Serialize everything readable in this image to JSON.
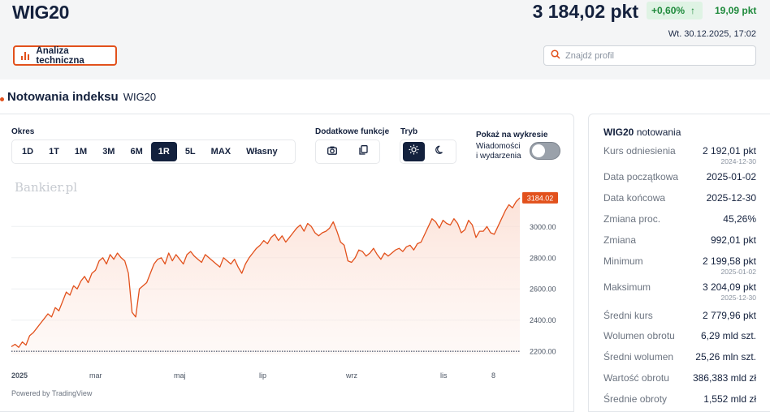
{
  "header": {
    "ticker": "WIG20",
    "price": "3 184,02 pkt",
    "change_pct": "+0,60%",
    "change_pkt": "19,09 pkt",
    "datetime": "Wt. 30.12.2025, 17:02",
    "tech_analysis_label": "Analiza techniczna",
    "search_placeholder": "Znajdź profil"
  },
  "section": {
    "title": "Notowania indeksu",
    "subtitle": "WIG20"
  },
  "controls": {
    "period_label": "Okres",
    "periods": [
      "1D",
      "1T",
      "1M",
      "3M",
      "6M",
      "1R",
      "5L",
      "MAX",
      "Własny"
    ],
    "active_period": "1R",
    "functions_label": "Dodatkowe funkcje",
    "mode_label": "Tryb",
    "show_label": "Pokaż na wykresie",
    "events_line1": "Wiadomości",
    "events_line2": "i wydarzenia"
  },
  "chart": {
    "watermark": "Bankier.pl",
    "powered_by": "Powered by TradingView",
    "last_label": "3184.02",
    "accent_color": "#e2511c"
  },
  "chart_data": {
    "type": "area",
    "x_ticks": [
      "2025",
      "mar",
      "maj",
      "lip",
      "wrz",
      "lis",
      "8"
    ],
    "y_ticks": [
      "2200.00",
      "2400.00",
      "2600.00",
      "2800.00",
      "3000.00"
    ],
    "ylim": [
      2200,
      3220
    ],
    "y": [
      2230,
      2245,
      2225,
      2260,
      2240,
      2300,
      2320,
      2350,
      2380,
      2410,
      2440,
      2420,
      2480,
      2460,
      2520,
      2580,
      2560,
      2620,
      2600,
      2650,
      2680,
      2640,
      2700,
      2720,
      2780,
      2800,
      2760,
      2820,
      2790,
      2830,
      2800,
      2780,
      2700,
      2450,
      2420,
      2600,
      2620,
      2640,
      2700,
      2760,
      2790,
      2800,
      2760,
      2830,
      2780,
      2820,
      2790,
      2760,
      2820,
      2840,
      2810,
      2790,
      2770,
      2820,
      2800,
      2780,
      2760,
      2740,
      2800,
      2780,
      2760,
      2790,
      2740,
      2700,
      2760,
      2800,
      2830,
      2860,
      2880,
      2910,
      2890,
      2930,
      2950,
      2910,
      2940,
      2900,
      2930,
      2960,
      2990,
      3010,
      2970,
      3020,
      3000,
      2960,
      2940,
      2960,
      2970,
      2990,
      3030,
      2970,
      2900,
      2880,
      2780,
      2770,
      2800,
      2850,
      2840,
      2810,
      2830,
      2860,
      2820,
      2790,
      2830,
      2810,
      2830,
      2850,
      2860,
      2840,
      2870,
      2880,
      2850,
      2890,
      2900,
      2950,
      3000,
      3050,
      3030,
      2990,
      3040,
      3020,
      3010,
      3050,
      3020,
      2960,
      2980,
      3040,
      3010,
      2930,
      2970,
      2970,
      3000,
      2960,
      2950,
      3000,
      3050,
      3100,
      3140,
      3120,
      3160,
      3184.02
    ],
    "ylabel": "",
    "xlabel": ""
  },
  "summary": {
    "title_bold": "WIG20",
    "title_rest": "notowania",
    "rows": [
      {
        "label": "Kurs odniesienia",
        "value": "2 192,01 pkt",
        "sub": "2024-12-30"
      },
      {
        "label": "Data początkowa",
        "value": "2025-01-02"
      },
      {
        "label": "Data końcowa",
        "value": "2025-12-30"
      },
      {
        "label": "Zmiana proc.",
        "value": "45,26%"
      },
      {
        "label": "Zmiana",
        "value": "992,01 pkt"
      },
      {
        "label": "Minimum",
        "value": "2 199,58 pkt",
        "sub": "2025-01-02"
      },
      {
        "label": "Maksimum",
        "value": "3 204,09 pkt",
        "sub": "2025-12-30"
      },
      {
        "label": "Średni kurs",
        "value": "2 779,96 pkt"
      },
      {
        "label": "Wolumen obrotu",
        "value": "6,29 mld szt."
      },
      {
        "label": "Średni wolumen",
        "value": "25,26 mln szt."
      },
      {
        "label": "Wartość obrotu",
        "value": "386,383 mld zł"
      },
      {
        "label": "Średnie obroty",
        "value": "1,552 mld zł"
      }
    ]
  }
}
